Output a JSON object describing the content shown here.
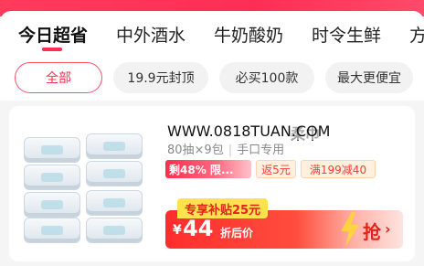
{
  "nav": {
    "tabs": [
      {
        "label": "今日超省",
        "active": true
      },
      {
        "label": "中外酒水",
        "active": false
      },
      {
        "label": "牛奶酸奶",
        "active": false
      },
      {
        "label": "时令生鲜",
        "active": false
      },
      {
        "label": "方",
        "active": false
      }
    ]
  },
  "filters": {
    "chips": [
      {
        "label": "全部",
        "active": true
      },
      {
        "label": "19.9元封顶",
        "active": false
      },
      {
        "label": "必买100款",
        "active": false
      },
      {
        "label": "最大更便宜",
        "active": false
      }
    ]
  },
  "product": {
    "title": "柔巾",
    "watermark": "WWW.0818TUAN.COM",
    "spec_count": "80抽×9包",
    "spec_type": "手口专用",
    "tag_stock": "剩48% 限...",
    "tag_cashback": "返5元",
    "tag_full_reduction": "满199减40",
    "subsidy": "专享补贴25元",
    "price_sign": "¥",
    "price": "44",
    "price_label": "折后价",
    "buy_label": "抢",
    "buy_arrow": "›"
  },
  "colors": {
    "accent": "#ff2d4f",
    "price_bar": "#ff2d2d",
    "subsidy_bg": "#ffe24d",
    "bolt": "#ffd23f"
  }
}
